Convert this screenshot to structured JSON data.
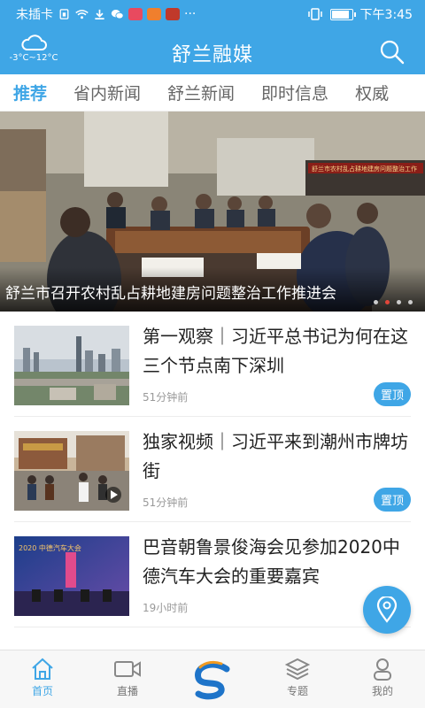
{
  "status_bar": {
    "carrier": "未插卡",
    "dots": "···",
    "time": "下午3:45"
  },
  "header": {
    "title": "舒兰融媒",
    "weather_temp": "-3°C~12°C",
    "weather_icon": "cloud-icon",
    "search_icon": "search-icon"
  },
  "tabs": [
    {
      "label": "推荐",
      "active": true
    },
    {
      "label": "省内新闻",
      "active": false
    },
    {
      "label": "舒兰新闻",
      "active": false
    },
    {
      "label": "即时信息",
      "active": false
    },
    {
      "label": "权威",
      "active": false
    }
  ],
  "banner": {
    "caption": "舒兰市召开农村乱占耕地建房问题整治工作推进会",
    "screen_text": "舒兰市农村乱占耕地建房问题整治工作"
  },
  "news": [
    {
      "headline": "第一观察｜习近平总书记为何在这三个节点南下深圳",
      "time": "51分钟前",
      "pin": "置顶"
    },
    {
      "headline": "独家视频｜习近平来到潮州市牌坊街",
      "time": "51分钟前",
      "pin": "置顶"
    },
    {
      "headline": "巴音朝鲁景俊海会见参加2020中德汽车大会的重要嘉宾",
      "time": "19小时前",
      "thumb_text": "2020 中德汽车大会"
    }
  ],
  "bottom_nav": [
    {
      "label": "首页",
      "icon": "home-icon",
      "active": true
    },
    {
      "label": "直播",
      "icon": "video-camera-icon",
      "active": false
    },
    {
      "label": "",
      "icon": "logo-icon",
      "active": false
    },
    {
      "label": "专题",
      "icon": "layers-icon",
      "active": false
    },
    {
      "label": "我的",
      "icon": "user-icon",
      "active": false
    }
  ],
  "colors": {
    "accent": "#3fa6e6",
    "banner_dot_active": "#e2463a"
  }
}
